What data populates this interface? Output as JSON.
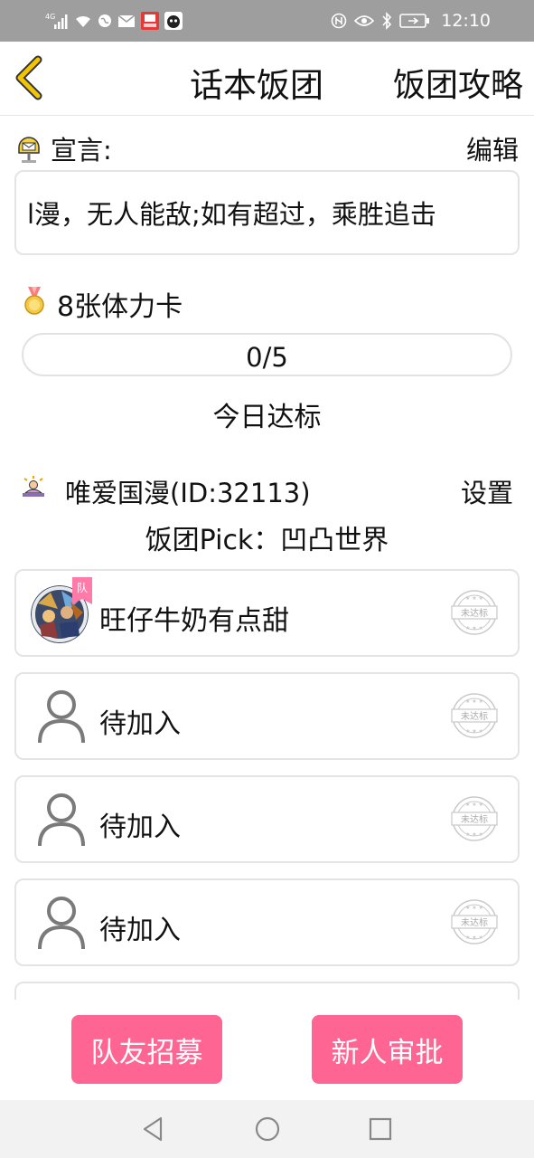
{
  "status_bar": {
    "network": "4G",
    "time": "12:10",
    "icons_left": [
      "signal-icon",
      "wifi-icon",
      "globe-icon",
      "mail-icon",
      "app-notification-icon",
      "pet-app-icon"
    ],
    "icons_right": [
      "nfc-icon",
      "eye-icon",
      "bluetooth-icon",
      "battery-icon"
    ]
  },
  "header": {
    "title": "话本饭团",
    "guide_label": "饭团攻略"
  },
  "declaration": {
    "label": "宣言:",
    "edit_label": "编辑",
    "text": "l漫，无人能敌;如有超过，乘胜追击"
  },
  "reward": {
    "label": "8张体力卡"
  },
  "progress": {
    "text": "0/5",
    "current": 0,
    "total": 5,
    "status": "今日达标"
  },
  "team": {
    "name": "唯爱国漫(ID:32113)",
    "settings_label": "设置",
    "pick": "饭团Pick：凹凸世界"
  },
  "members": [
    {
      "name": "旺仔牛奶有点甜",
      "badge": "队",
      "stamp": "未达标",
      "has_avatar": true
    },
    {
      "name": "待加入",
      "stamp": "未达标",
      "has_avatar": false
    },
    {
      "name": "待加入",
      "stamp": "未达标",
      "has_avatar": false
    },
    {
      "name": "待加入",
      "stamp": "未达标",
      "has_avatar": false
    },
    {
      "name": "",
      "stamp": "",
      "has_avatar": false
    }
  ],
  "buttons": {
    "recruit": "队友招募",
    "approve": "新人审批"
  },
  "colors": {
    "accent": "#ff6592",
    "back_arrow": "#e6b800",
    "status_bar": "#9e9e9e",
    "border": "#e4e4e4"
  }
}
